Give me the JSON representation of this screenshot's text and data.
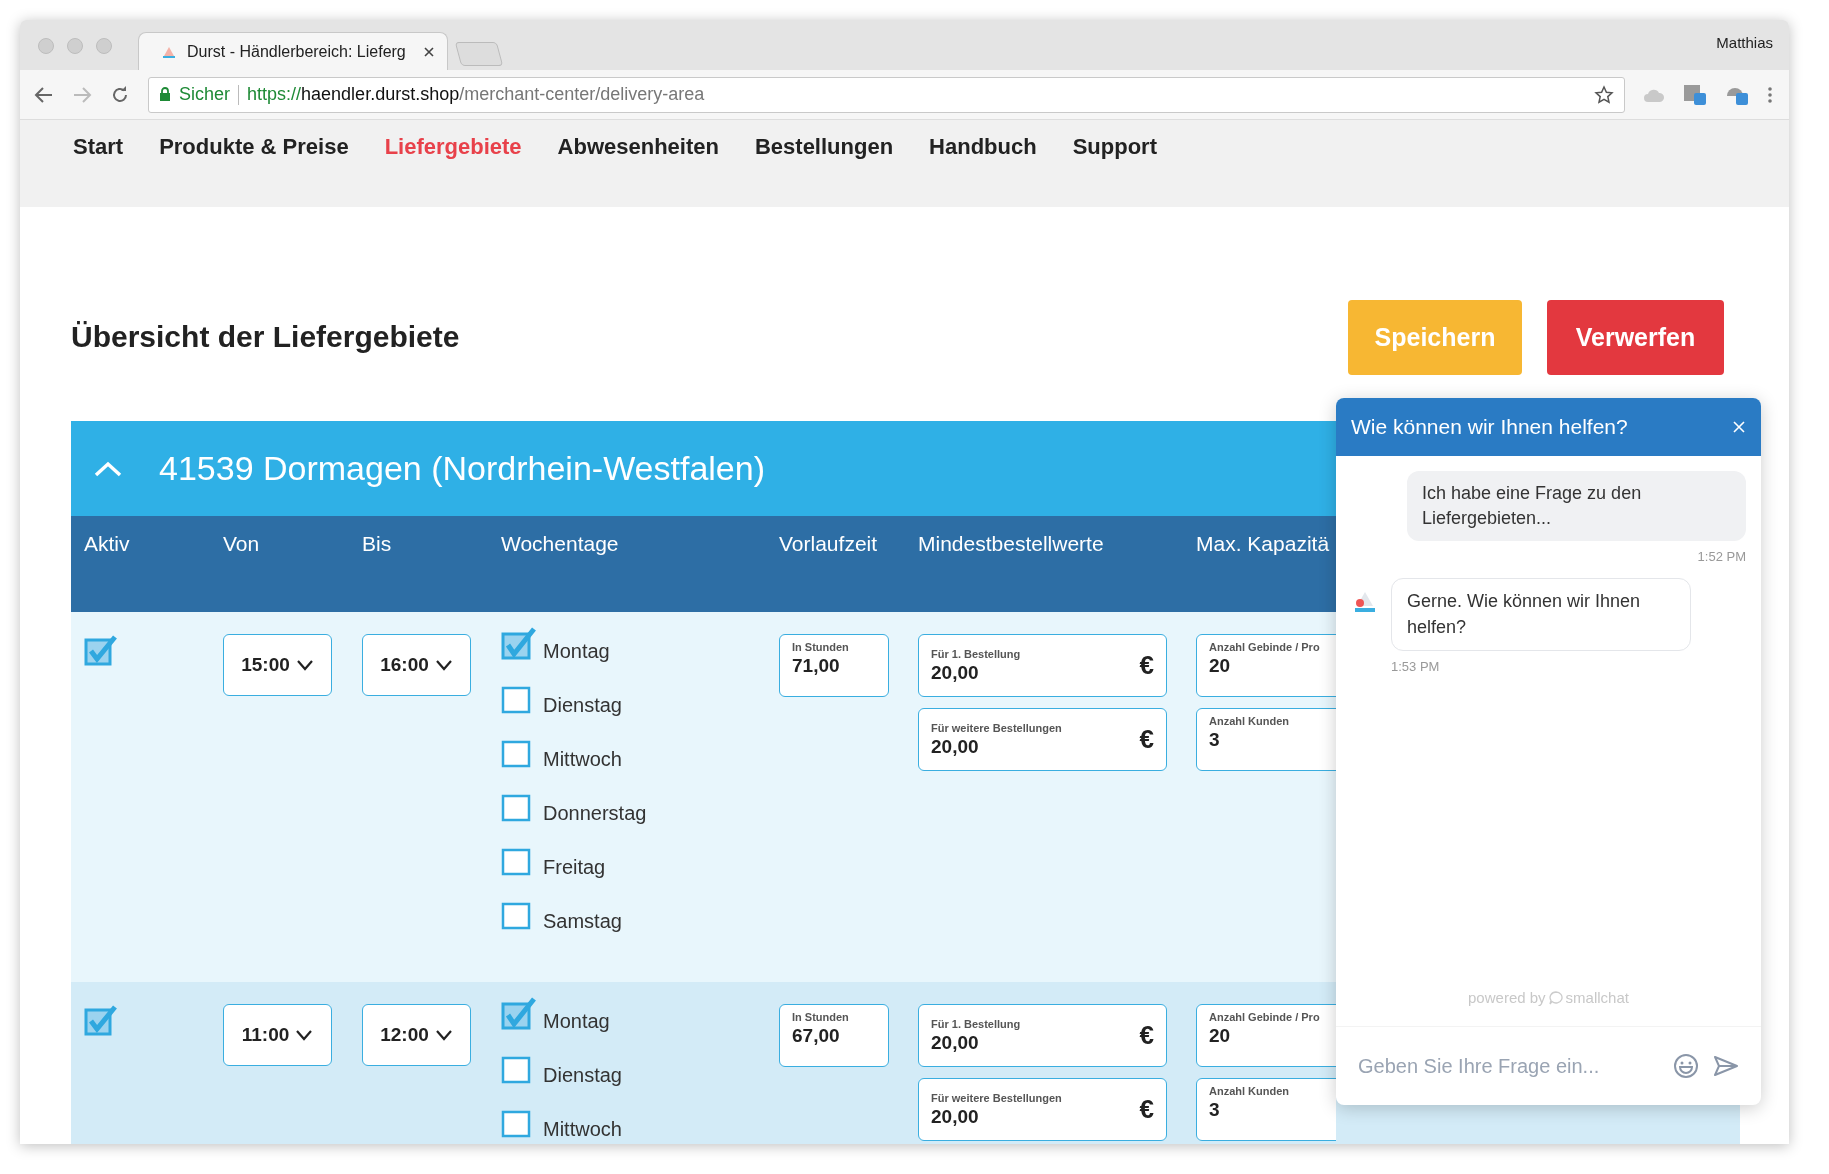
{
  "browser": {
    "tab_title": "Durst - Händlerbereich: Lieferg",
    "profile_name": "Matthias",
    "address": {
      "security_label": "Sicher",
      "scheme": "https://",
      "host": "haendler.durst.shop",
      "path": "/merchant-center/delivery-area"
    }
  },
  "nav": [
    {
      "label": "Start",
      "selected": false
    },
    {
      "label": "Produkte & Preise",
      "selected": false
    },
    {
      "label": "Liefergebiete",
      "selected": true
    },
    {
      "label": "Abwesenheiten",
      "selected": false
    },
    {
      "label": "Bestellungen",
      "selected": false
    },
    {
      "label": "Handbuch",
      "selected": false
    },
    {
      "label": "Support",
      "selected": false
    }
  ],
  "page": {
    "title": "Übersicht der Liefergebiete",
    "buttons": [
      {
        "label": "Speichern",
        "kind": "save"
      },
      {
        "label": "Verwerfen",
        "kind": "discard"
      }
    ]
  },
  "area": {
    "title": "41539 Dormagen (Nordrhein-Westfalen)",
    "expanded": true,
    "columns": [
      "Aktiv",
      "Von",
      "Bis",
      "Wochentage",
      "Vorlaufzeit",
      "Mindestbestellwerte",
      "Max. Kapazitä"
    ],
    "rows": [
      {
        "active": true,
        "from": "15:00",
        "to": "16:00",
        "weekdays": [
          {
            "label": "Montag",
            "checked": true
          },
          {
            "label": "Dienstag",
            "checked": false
          },
          {
            "label": "Mittwoch",
            "checked": false
          },
          {
            "label": "Donnerstag",
            "checked": false
          },
          {
            "label": "Freitag",
            "checked": false
          },
          {
            "label": "Samstag",
            "checked": false
          }
        ],
        "lead_time": {
          "label": "In Stunden",
          "value": "71,00"
        },
        "min_order": [
          {
            "label": "Für 1. Bestellung",
            "value": "20,00",
            "currency": "€"
          },
          {
            "label": "Für weitere Bestellungen",
            "value": "20,00",
            "currency": "€"
          }
        ],
        "capacity": [
          {
            "label": "Anzahl Gebinde / Pro",
            "value": "20"
          },
          {
            "label": "Anzahl Kunden",
            "value": "3"
          }
        ]
      },
      {
        "active": true,
        "from": "11:00",
        "to": "12:00",
        "weekdays": [
          {
            "label": "Montag",
            "checked": true
          },
          {
            "label": "Dienstag",
            "checked": false
          },
          {
            "label": "Mittwoch",
            "checked": false
          }
        ],
        "lead_time": {
          "label": "In Stunden",
          "value": "67,00"
        },
        "min_order": [
          {
            "label": "Für 1. Bestellung",
            "value": "20,00",
            "currency": "€"
          },
          {
            "label": "Für weitere Bestellungen",
            "value": "20,00",
            "currency": "€"
          }
        ],
        "capacity": [
          {
            "label": "Anzahl Gebinde / Pro",
            "value": "20"
          },
          {
            "label": "Anzahl Kunden",
            "value": "3"
          }
        ]
      }
    ]
  },
  "chat": {
    "title": "Wie können wir Ihnen helfen?",
    "messages": [
      {
        "kind": "outgoing",
        "text": "Ich habe eine Frage zu den Liefergebieten...",
        "time": "1:52 PM"
      },
      {
        "kind": "incoming",
        "text": "Gerne. Wie können wir Ihnen helfen?",
        "time": "1:53 PM"
      }
    ],
    "powered_by": "powered by",
    "brand": "smallchat",
    "placeholder": "Geben Sie Ihre Frage ein..."
  }
}
